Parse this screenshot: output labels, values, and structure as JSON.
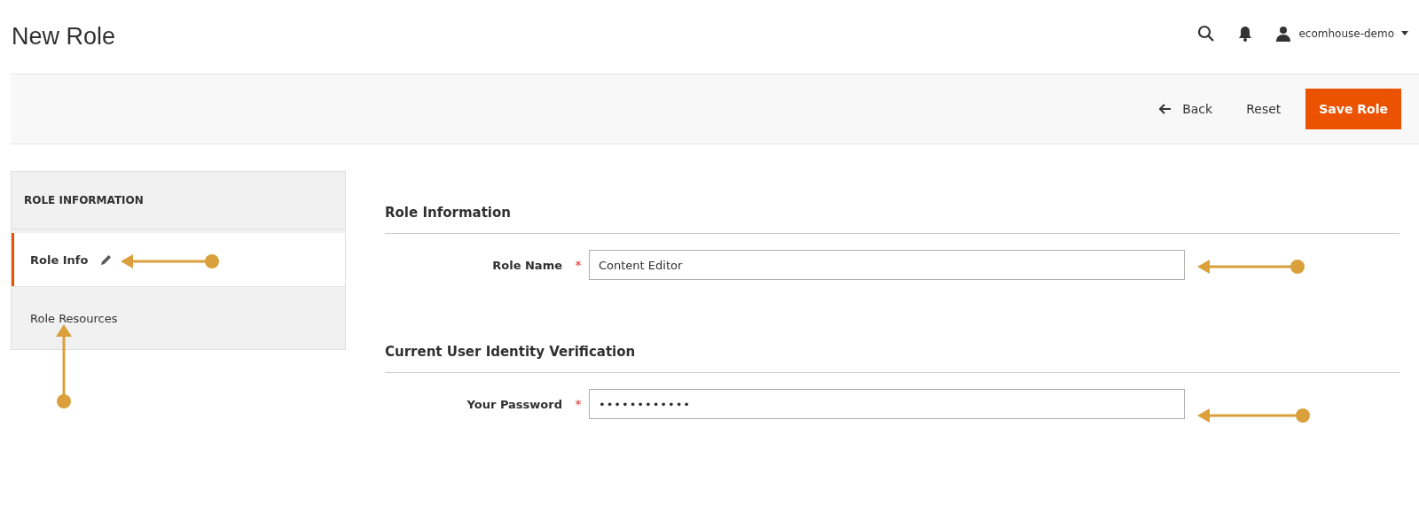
{
  "page_title": "New Role",
  "header": {
    "user": "ecomhouse-demo"
  },
  "actions": {
    "back": "Back",
    "reset": "Reset",
    "save": "Save Role"
  },
  "sidebar": {
    "title": "ROLE INFORMATION",
    "items": [
      {
        "label": "Role Info",
        "selected": true,
        "edited": true
      },
      {
        "label": "Role Resources",
        "selected": false,
        "edited": false
      }
    ]
  },
  "sections": [
    {
      "title": "Role Information",
      "fields": [
        {
          "label": "Role Name",
          "required_mark": "*",
          "value": "Content Editor"
        }
      ]
    },
    {
      "title": "Current User Identity Verification",
      "fields": [
        {
          "label": "Your Password",
          "required_mark": "*",
          "value": "••••••••••••"
        }
      ]
    }
  ],
  "annotations": [
    {
      "kind": "left"
    },
    {
      "kind": "up"
    },
    {
      "kind": "left"
    },
    {
      "kind": "left"
    }
  ]
}
